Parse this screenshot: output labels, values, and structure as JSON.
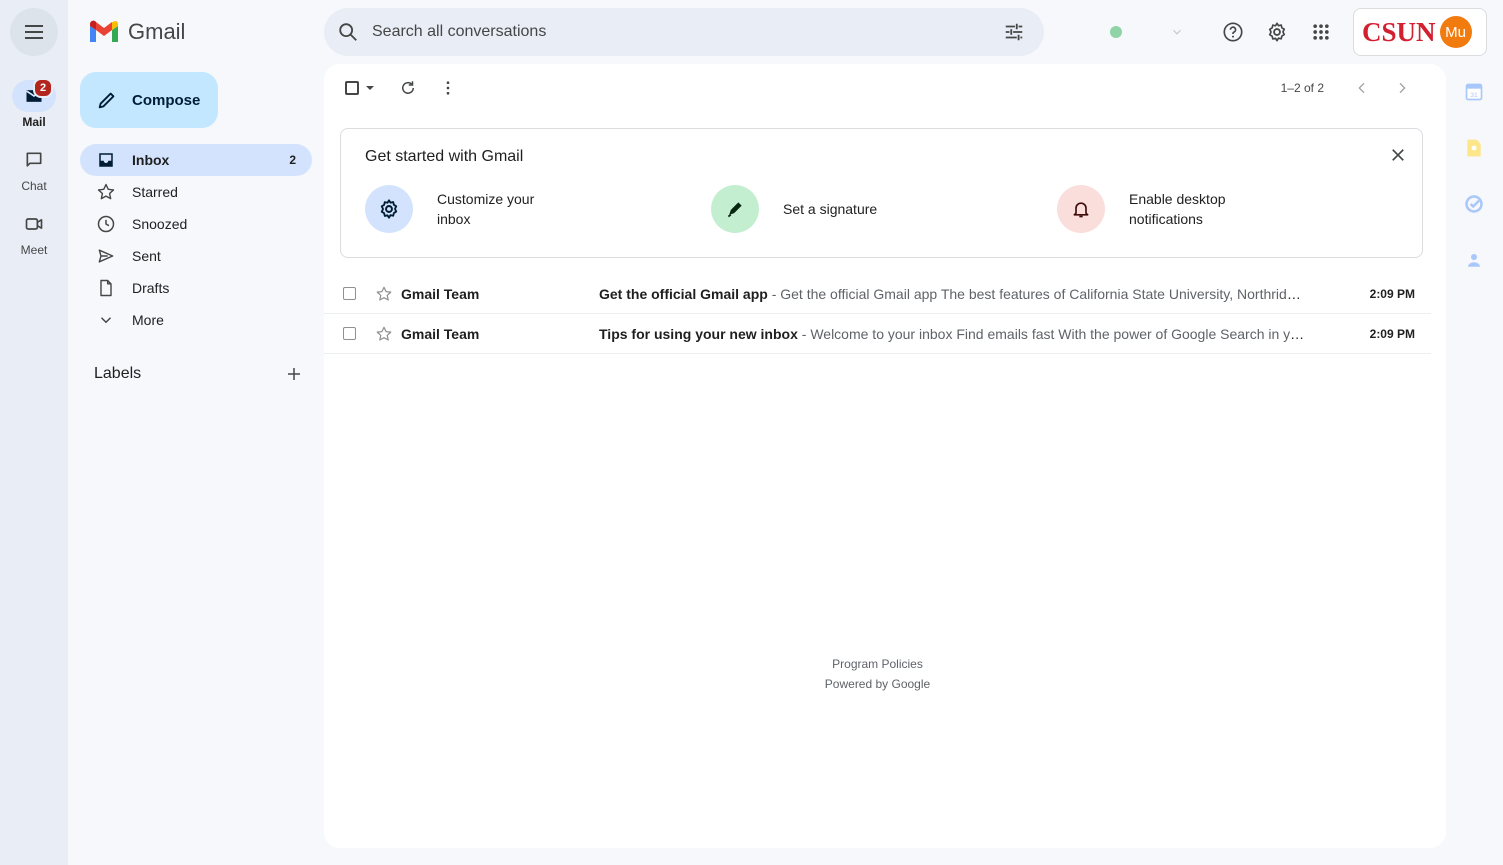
{
  "app": {
    "name": "Gmail"
  },
  "rail": {
    "items": [
      {
        "label": "Mail",
        "badge": "2"
      },
      {
        "label": "Chat"
      },
      {
        "label": "Meet"
      }
    ]
  },
  "search": {
    "placeholder": "Search all conversations"
  },
  "account": {
    "org_logo": "CSUN",
    "avatar_initials": "Mu",
    "avatar_color": "#f27b0f"
  },
  "compose": {
    "label": "Compose"
  },
  "nav": [
    {
      "label": "Inbox",
      "count": "2",
      "icon": "inbox-icon"
    },
    {
      "label": "Starred",
      "icon": "star-icon"
    },
    {
      "label": "Snoozed",
      "icon": "clock-icon"
    },
    {
      "label": "Sent",
      "icon": "send-icon"
    },
    {
      "label": "Drafts",
      "icon": "draft-icon"
    },
    {
      "label": "More",
      "icon": "chevron-down-icon"
    }
  ],
  "labels": {
    "title": "Labels"
  },
  "toolbar": {
    "page_info": "1–2 of 2"
  },
  "get_started": {
    "title": "Get started with Gmail",
    "items": [
      {
        "label": "Customize your inbox",
        "icon": "gear-icon",
        "color": "#d3e3fd"
      },
      {
        "label": "Set a signature",
        "icon": "pen-icon",
        "color": "#c4eed0"
      },
      {
        "label": "Enable desktop notifications",
        "icon": "bell-icon",
        "color": "#f9dedc"
      }
    ]
  },
  "emails": [
    {
      "sender": "Gmail Team",
      "subject": "Get the official Gmail app",
      "snippet": " - Get the official Gmail app The best features of California State University, Northridge Mail are only available on your phone and tablet with the official Gmail app",
      "time": "2:09 PM"
    },
    {
      "sender": "Gmail Team",
      "subject": "Tips for using your new inbox",
      "snippet": " - Welcome to your inbox Find emails fast With the power of Google Search in your inbox, you can search for emails",
      "time": "2:09 PM"
    }
  ],
  "footer": {
    "policies": "Program Policies",
    "powered": "Powered by Google"
  },
  "colors": {
    "accent": "#0b57d0",
    "compose": "#c2e7ff",
    "active_nav": "#d3e3fd",
    "background": "#f6f8fc"
  }
}
